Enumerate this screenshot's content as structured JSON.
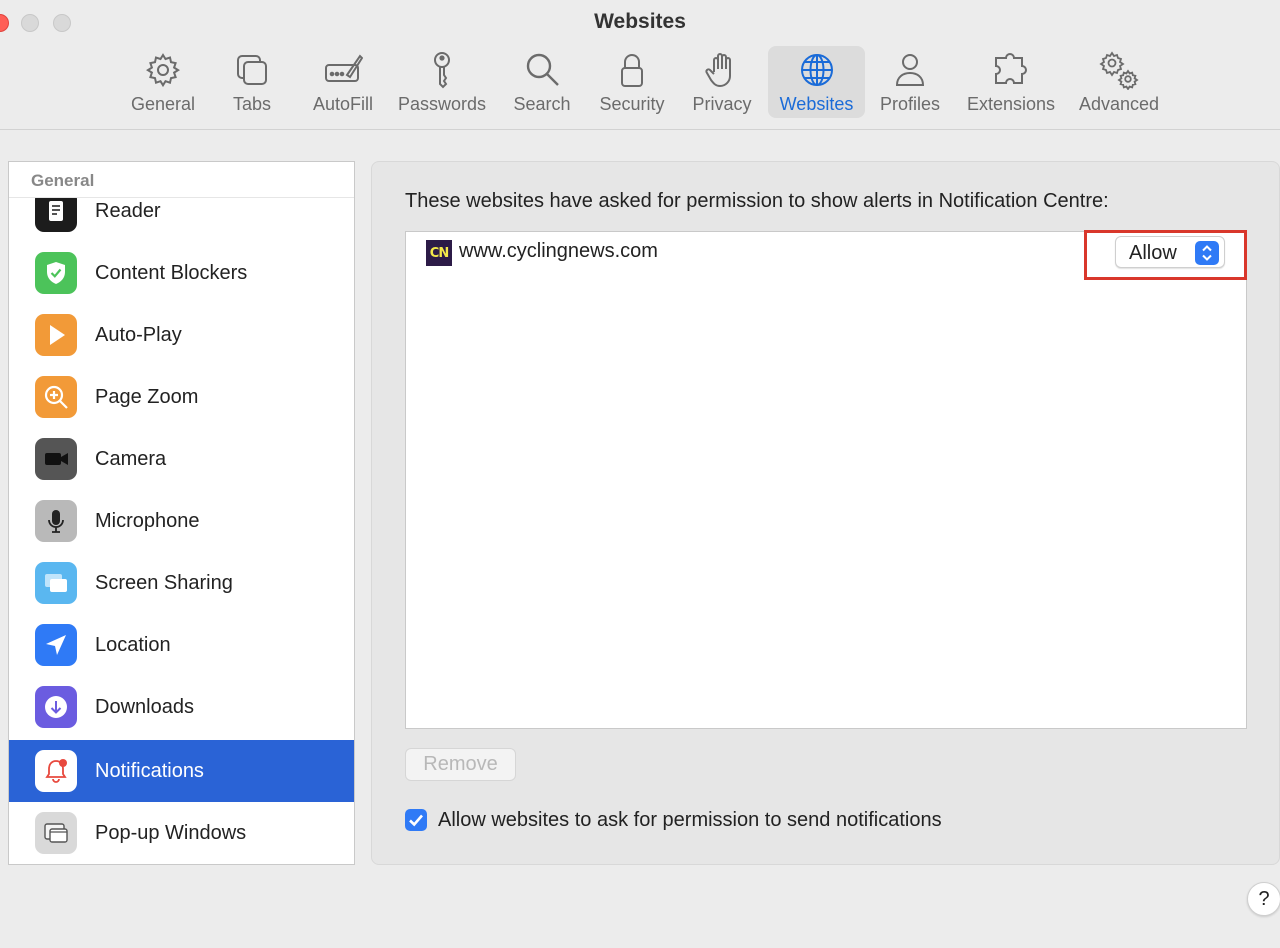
{
  "window": {
    "title": "Websites"
  },
  "toolbar": {
    "items": [
      {
        "label": "General",
        "icon": "gear-icon"
      },
      {
        "label": "Tabs",
        "icon": "tabs-icon"
      },
      {
        "label": "AutoFill",
        "icon": "autofill-icon"
      },
      {
        "label": "Passwords",
        "icon": "key-icon"
      },
      {
        "label": "Search",
        "icon": "magnifier-icon"
      },
      {
        "label": "Security",
        "icon": "lock-icon"
      },
      {
        "label": "Privacy",
        "icon": "hand-icon"
      },
      {
        "label": "Websites",
        "icon": "globe-icon",
        "active": true
      },
      {
        "label": "Profiles",
        "icon": "person-icon"
      },
      {
        "label": "Extensions",
        "icon": "puzzle-icon"
      },
      {
        "label": "Advanced",
        "icon": "gears-icon"
      }
    ],
    "active_color": "#1a6bd8"
  },
  "sidebar": {
    "section_header": "General",
    "items": [
      {
        "label": "Reader",
        "icon": "reader-icon"
      },
      {
        "label": "Content Blockers",
        "icon": "shield-check-icon"
      },
      {
        "label": "Auto-Play",
        "icon": "play-icon"
      },
      {
        "label": "Page Zoom",
        "icon": "zoom-icon"
      },
      {
        "label": "Camera",
        "icon": "camera-icon"
      },
      {
        "label": "Microphone",
        "icon": "microphone-icon"
      },
      {
        "label": "Screen Sharing",
        "icon": "screen-sharing-icon"
      },
      {
        "label": "Location",
        "icon": "location-arrow-icon"
      },
      {
        "label": "Downloads",
        "icon": "download-icon"
      },
      {
        "label": "Notifications",
        "icon": "bell-icon",
        "selected": true
      },
      {
        "label": "Pop-up Windows",
        "icon": "popup-windows-icon"
      }
    ],
    "selected_color": "#2a63d6"
  },
  "main": {
    "prompt": "These websites have asked for permission to show alerts in Notification Centre:",
    "sites": [
      {
        "favicon_text": "CN",
        "name": "www.cyclingnews.com",
        "permission": "Allow"
      }
    ],
    "remove_label": "Remove",
    "checkbox_label": "Allow websites to ask for permission to send notifications",
    "checkbox_checked": true
  },
  "help": {
    "label": "?"
  }
}
